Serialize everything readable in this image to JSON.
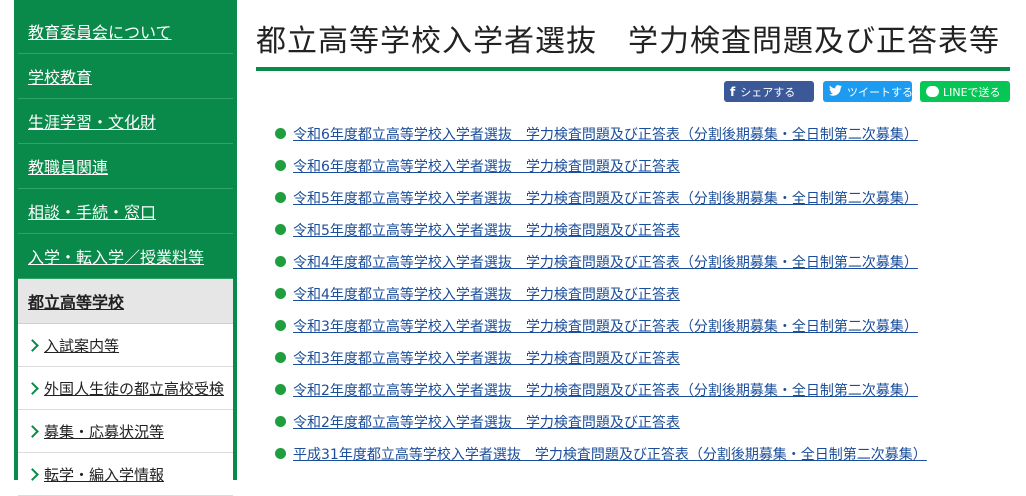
{
  "sidebar": {
    "items": [
      {
        "label": "教育委員会について"
      },
      {
        "label": "学校教育"
      },
      {
        "label": "生涯学習・文化財"
      },
      {
        "label": "教職員関連"
      },
      {
        "label": "相談・手続・窓口"
      },
      {
        "label": "入学・転入学／授業料等"
      }
    ],
    "current": {
      "label": "都立高等学校"
    },
    "subitems": [
      {
        "label": "入試案内等"
      },
      {
        "label": "外国人生徒の都立高校受検"
      },
      {
        "label": "募集・応募状況等"
      },
      {
        "label": "転学・編入学情報"
      }
    ]
  },
  "main": {
    "title": "都立高等学校入学者選抜　学力検査問題及び正答表等",
    "share": {
      "facebook": {
        "icon": "f",
        "label": "シェアする"
      },
      "twitter": {
        "icon": "bird",
        "label": "ツイートする"
      },
      "line": {
        "label": "LINEで送る"
      }
    },
    "links": [
      "令和6年度都立高等学校入学者選抜　学力検査問題及び正答表（分割後期募集・全日制第二次募集）",
      "令和6年度都立高等学校入学者選抜　学力検査問題及び正答表",
      "令和5年度都立高等学校入学者選抜　学力検査問題及び正答表（分割後期募集・全日制第二次募集）",
      "令和5年度都立高等学校入学者選抜　学力検査問題及び正答表",
      "令和4年度都立高等学校入学者選抜　学力検査問題及び正答表（分割後期募集・全日制第二次募集）",
      "令和4年度都立高等学校入学者選抜　学力検査問題及び正答表",
      "令和3年度都立高等学校入学者選抜　学力検査問題及び正答表（分割後期募集・全日制第二次募集）",
      "令和3年度都立高等学校入学者選抜　学力検査問題及び正答表",
      "令和2年度都立高等学校入学者選抜　学力検査問題及び正答表（分割後期募集・全日制第二次募集）",
      "令和2年度都立高等学校入学者選抜　学力検査問題及び正答表",
      "平成31年度都立高等学校入学者選抜　学力検査問題及び正答表（分割後期募集・全日制第二次募集）"
    ]
  },
  "colors": {
    "brand_green": "#0a8a4a",
    "link_blue": "#1a4d9a",
    "bullet_green": "#1f9e3f"
  }
}
